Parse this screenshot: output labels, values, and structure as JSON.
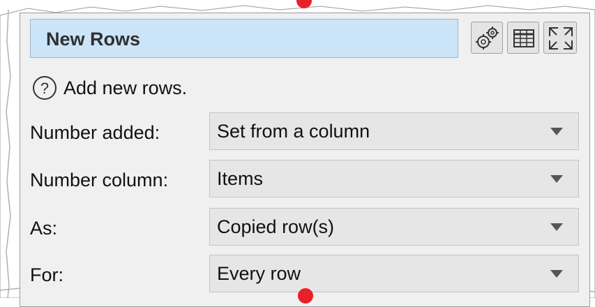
{
  "node": {
    "title": "New Rows",
    "help_text": "Add new rows.",
    "header_icons": [
      "gear-icon",
      "table-icon",
      "maximize-icon"
    ],
    "accent_color": "#cce4f7"
  },
  "fields": [
    {
      "label": "Number added:",
      "value": "Set from a column"
    },
    {
      "label": "Number column:",
      "value": "Items"
    },
    {
      "label": "As:",
      "value": "Copied row(s)"
    },
    {
      "label": "For:",
      "value": "Every row"
    }
  ],
  "connector_color": "#e8202a"
}
